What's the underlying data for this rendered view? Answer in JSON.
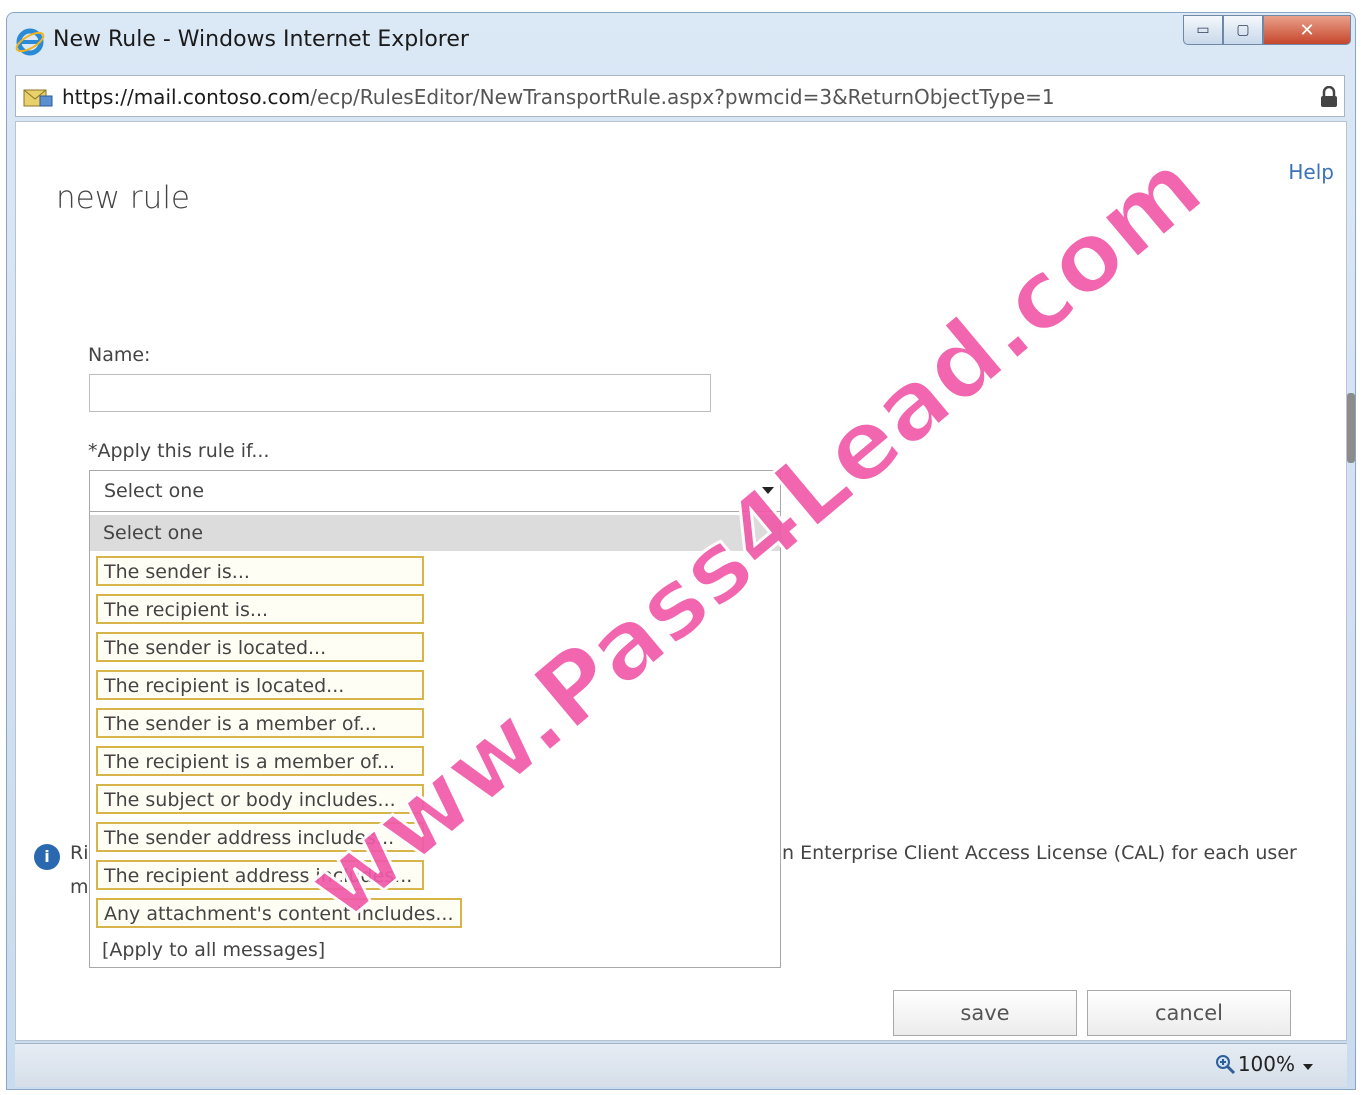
{
  "window": {
    "title": "New Rule - Windows Internet Explorer",
    "address": {
      "scheme": "https",
      "host": "://mail.contoso.com",
      "path": "/ecp/RulesEditor/NewTransportRule.aspx?pwmcid=3&ReturnObjectType=1"
    },
    "controls": {
      "minimize": "▭",
      "maximize": "▢",
      "close": "✕"
    }
  },
  "page": {
    "help": "Help",
    "title": "new rule",
    "name_label": "Name:",
    "name_value": "",
    "apply_label": "*Apply this rule if...",
    "select_value": "Select one",
    "dropdown": {
      "selected": "Select one",
      "options": [
        "The sender is...",
        "The recipient is...",
        "The sender is located...",
        "The recipient is located...",
        "The sender is a member of...",
        "The recipient is a member of...",
        "The subject or body includes...",
        "The sender address includes...",
        "The recipient address includes...",
        "Any attachment's content includes..."
      ],
      "last_option": "[Apply to all messages]"
    },
    "info": {
      "left_line1": "Ri",
      "left_line2": "m",
      "right": "n Enterprise Client Access License (CAL) for each user"
    },
    "buttons": {
      "save": "save",
      "cancel": "cancel"
    }
  },
  "statusbar": {
    "zoom": "100%"
  },
  "watermark": "www.Pass4Lead.com",
  "colors": {
    "highlight_border": "#d7b54a",
    "watermark": "#f05aa8",
    "link": "#3b73b9"
  }
}
